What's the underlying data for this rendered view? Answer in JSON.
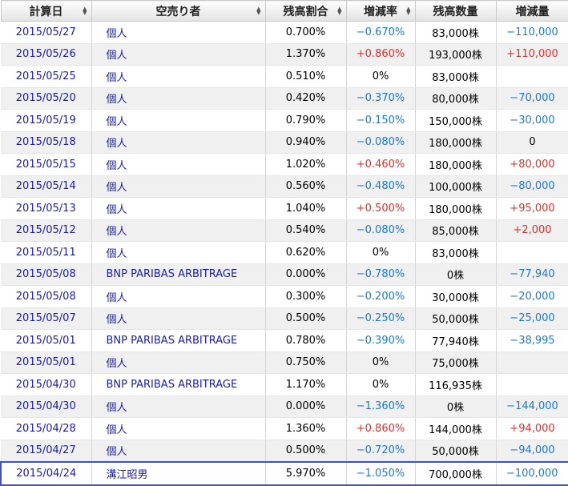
{
  "headers": [
    {
      "label": "計算日",
      "sortable": true
    },
    {
      "label": "空売り者",
      "sortable": true
    },
    {
      "label": "残高割合",
      "sortable": true
    },
    {
      "label": "増減率",
      "sortable": true
    },
    {
      "label": "残高数量",
      "sortable": false
    },
    {
      "label": "増減量",
      "sortable": false
    }
  ],
  "rows": [
    {
      "date": "2015/05/27",
      "seller": "個人",
      "ratio": "0.700%",
      "rate": "−0.670%",
      "rate_sign": "neg",
      "qty": "83,000株",
      "change": "−110,000",
      "change_sign": "neg"
    },
    {
      "date": "2015/05/26",
      "seller": "個人",
      "ratio": "1.370%",
      "rate": "+0.860%",
      "rate_sign": "pos",
      "qty": "193,000株",
      "change": "+110,000",
      "change_sign": "pos"
    },
    {
      "date": "2015/05/25",
      "seller": "個人",
      "ratio": "0.510%",
      "rate": "0%",
      "rate_sign": "zero",
      "qty": "83,000株",
      "change": "",
      "change_sign": "zero"
    },
    {
      "date": "2015/05/20",
      "seller": "個人",
      "ratio": "0.420%",
      "rate": "−0.370%",
      "rate_sign": "neg",
      "qty": "80,000株",
      "change": "−70,000",
      "change_sign": "neg"
    },
    {
      "date": "2015/05/19",
      "seller": "個人",
      "ratio": "0.790%",
      "rate": "−0.150%",
      "rate_sign": "neg",
      "qty": "150,000株",
      "change": "−30,000",
      "change_sign": "neg"
    },
    {
      "date": "2015/05/18",
      "seller": "個人",
      "ratio": "0.940%",
      "rate": "−0.080%",
      "rate_sign": "neg",
      "qty": "180,000株",
      "change": "0",
      "change_sign": "zero"
    },
    {
      "date": "2015/05/15",
      "seller": "個人",
      "ratio": "1.020%",
      "rate": "+0.460%",
      "rate_sign": "pos",
      "qty": "180,000株",
      "change": "+80,000",
      "change_sign": "pos"
    },
    {
      "date": "2015/05/14",
      "seller": "個人",
      "ratio": "0.560%",
      "rate": "−0.480%",
      "rate_sign": "neg",
      "qty": "100,000株",
      "change": "−80,000",
      "change_sign": "neg"
    },
    {
      "date": "2015/05/13",
      "seller": "個人",
      "ratio": "1.040%",
      "rate": "+0.500%",
      "rate_sign": "pos",
      "qty": "180,000株",
      "change": "+95,000",
      "change_sign": "pos"
    },
    {
      "date": "2015/05/12",
      "seller": "個人",
      "ratio": "0.540%",
      "rate": "−0.080%",
      "rate_sign": "neg",
      "qty": "85,000株",
      "change": "+2,000",
      "change_sign": "pos"
    },
    {
      "date": "2015/05/11",
      "seller": "個人",
      "ratio": "0.620%",
      "rate": "0%",
      "rate_sign": "zero",
      "qty": "83,000株",
      "change": "",
      "change_sign": "zero"
    },
    {
      "date": "2015/05/08",
      "seller": "BNP PARIBAS ARBITRAGE",
      "ratio": "0.000%",
      "rate": "−0.780%",
      "rate_sign": "neg",
      "qty": "0株",
      "change": "−77,940",
      "change_sign": "neg"
    },
    {
      "date": "2015/05/08",
      "seller": "個人",
      "ratio": "0.300%",
      "rate": "−0.200%",
      "rate_sign": "neg",
      "qty": "30,000株",
      "change": "−20,000",
      "change_sign": "neg"
    },
    {
      "date": "2015/05/07",
      "seller": "個人",
      "ratio": "0.500%",
      "rate": "−0.250%",
      "rate_sign": "neg",
      "qty": "50,000株",
      "change": "−25,000",
      "change_sign": "neg"
    },
    {
      "date": "2015/05/01",
      "seller": "BNP PARIBAS ARBITRAGE",
      "ratio": "0.780%",
      "rate": "−0.390%",
      "rate_sign": "neg",
      "qty": "77,940株",
      "change": "−38,995",
      "change_sign": "neg"
    },
    {
      "date": "2015/05/01",
      "seller": "個人",
      "ratio": "0.750%",
      "rate": "0%",
      "rate_sign": "zero",
      "qty": "75,000株",
      "change": "",
      "change_sign": "zero"
    },
    {
      "date": "2015/04/30",
      "seller": "BNP PARIBAS ARBITRAGE",
      "ratio": "1.170%",
      "rate": "0%",
      "rate_sign": "zero",
      "qty": "116,935株",
      "change": "",
      "change_sign": "zero"
    },
    {
      "date": "2015/04/30",
      "seller": "個人",
      "ratio": "0.000%",
      "rate": "−1.360%",
      "rate_sign": "neg",
      "qty": "0株",
      "change": "−144,000",
      "change_sign": "neg"
    },
    {
      "date": "2015/04/28",
      "seller": "個人",
      "ratio": "1.360%",
      "rate": "+0.860%",
      "rate_sign": "pos",
      "qty": "144,000株",
      "change": "+94,000",
      "change_sign": "pos"
    },
    {
      "date": "2015/04/27",
      "seller": "個人",
      "ratio": "0.500%",
      "rate": "−0.720%",
      "rate_sign": "neg",
      "qty": "50,000株",
      "change": "−94,000",
      "change_sign": "neg"
    },
    {
      "date": "2015/04/24",
      "seller": "溝江昭男",
      "ratio": "5.970%",
      "rate": "−1.050%",
      "rate_sign": "neg",
      "qty": "700,000株",
      "change": "−100,000",
      "change_sign": "neg",
      "highlighted": true
    }
  ],
  "colors": {
    "negative": "#1e78d0",
    "positive": "#e03030",
    "link": "#1a1ab4",
    "highlight_border": "#3d52c8"
  },
  "icons": {
    "sort": "sort-arrows-icon"
  }
}
